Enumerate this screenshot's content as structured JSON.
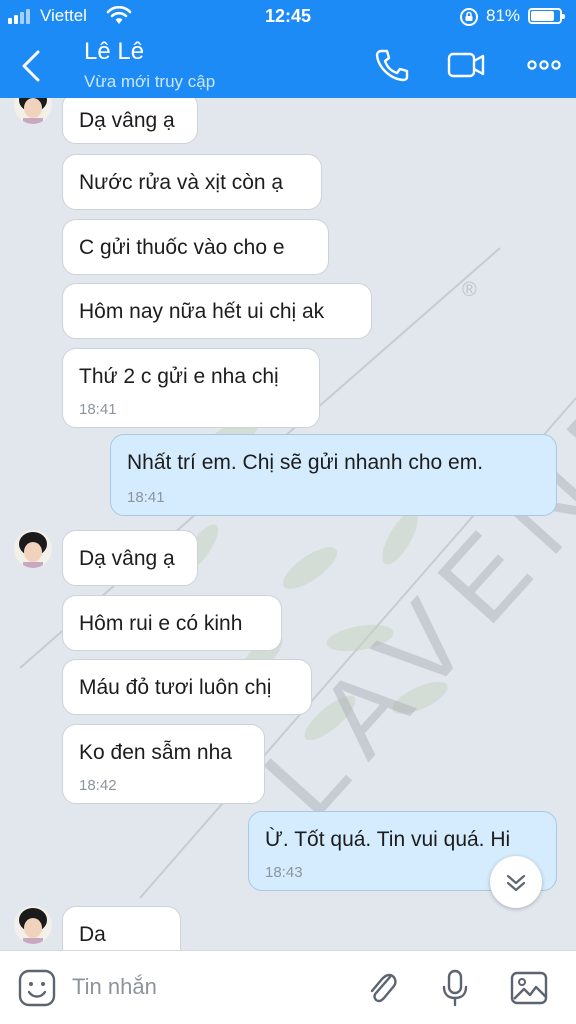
{
  "status_bar": {
    "carrier": "Viettel",
    "time": "12:45",
    "battery_percent": "81%",
    "battery_level": 0.81
  },
  "header": {
    "contact_name": "Lê Lê",
    "status_text": "Vừa mới truy cập",
    "icons": [
      "back-icon",
      "phone-icon",
      "video-icon",
      "more-icon"
    ]
  },
  "watermark": {
    "brand": "LAVENDA",
    "registered_mark": "®"
  },
  "messages": [
    {
      "from": "them",
      "text": "Dạ vâng ạ"
    },
    {
      "from": "them",
      "text": "Nước rửa và xịt còn ạ"
    },
    {
      "from": "them",
      "text": "C gửi thuốc vào cho e"
    },
    {
      "from": "them",
      "text": "Hôm nay nữa hết ui chị ak"
    },
    {
      "from": "them",
      "text": "Thứ 2 c gửi e nha chị",
      "time": "18:41"
    },
    {
      "from": "me",
      "text": "Nhất trí em. Chị sẽ gửi nhanh cho em.",
      "time": "18:41"
    },
    {
      "from": "them",
      "text": "Dạ vâng ạ"
    },
    {
      "from": "them",
      "text": "Hôm rui e có kinh"
    },
    {
      "from": "them",
      "text": "Máu đỏ tươi luôn chị"
    },
    {
      "from": "them",
      "text": "Ko đen sẫm nha",
      "time": "18:42"
    },
    {
      "from": "me",
      "text": "Ừ. Tốt quá. Tin vui quá. Hi",
      "time": "18:43"
    },
    {
      "from": "them",
      "text": "Da"
    }
  ],
  "input_bar": {
    "placeholder": "Tin nhắn",
    "icons": [
      "sticker-icon",
      "attach-icon",
      "microphone-icon",
      "image-icon"
    ]
  },
  "colors": {
    "header_bg": "#1c8bf5",
    "chat_bg": "#e2e7ee",
    "incoming_bubble": "#ffffff",
    "outgoing_bubble": "#d4ecfd"
  }
}
